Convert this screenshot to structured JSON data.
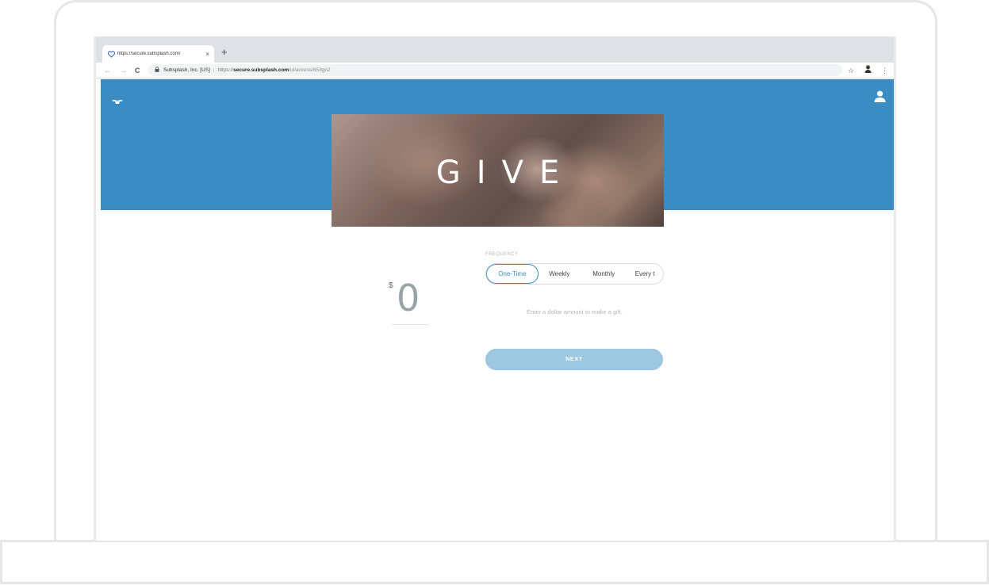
{
  "browser": {
    "tab_title": "https://secure.subsplash.com/",
    "new_tab": "+",
    "tab_close": "×",
    "nav": {
      "back": "←",
      "forward": "→",
      "reload": "C"
    },
    "site_identity": "Subsplash, Inc. [US]",
    "url_scheme": "https://",
    "url_host": "secure.subsplash.com",
    "url_path": "/ui/access/653gn2",
    "bookmark": "☆",
    "menu": "⋮"
  },
  "hero": {
    "title": "GIVE"
  },
  "amount": {
    "currency_symbol": "$",
    "value": "0"
  },
  "frequency": {
    "label": "FREQUENCY",
    "options": [
      "One-Time",
      "Weekly",
      "Monthly",
      "Every t"
    ],
    "selected": "One-Time"
  },
  "hint": "Enter a dollar amount to make a gift.",
  "next_button": "NEXT",
  "colors": {
    "brand_blue": "#3a8cc3",
    "button_disabled": "#9dc6e1"
  }
}
